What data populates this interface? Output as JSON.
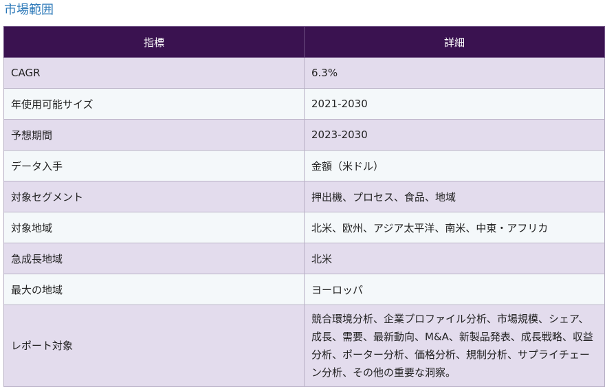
{
  "heading": "市場範囲",
  "table": {
    "headers": [
      "指標",
      "詳細"
    ],
    "rows": [
      {
        "label": "CAGR",
        "value": "6.3%"
      },
      {
        "label": "年使用可能サイズ",
        "value": "2021-2030"
      },
      {
        "label": "予想期間",
        "value": "2023-2030"
      },
      {
        "label": "データ入手",
        "value": "金額（米ドル）"
      },
      {
        "label": "対象セグメント",
        "value": "押出機、プロセス、食品、地域"
      },
      {
        "label": "対象地域",
        "value": "北米、欧州、アジア太平洋、南米、中東・アフリカ"
      },
      {
        "label": "急成長地域",
        "value": "北米"
      },
      {
        "label": "最大の地域",
        "value": "ヨーロッパ"
      },
      {
        "label": "レポート対象",
        "value": "競合環境分析、企業プロファイル分析、市場規模、シェア、成長、需要、最新動向、M&A、新製品発表、成長戦略、収益分析、ポーター分析、価格分析、規制分析、サプライチェーン分析、その他の重要な洞察。"
      }
    ]
  },
  "colors": {
    "heading_text": "#2b78b8",
    "header_bg": "#3a1250",
    "row_odd_bg": "#e3dced",
    "row_even_bg": "#f4f8fa"
  }
}
